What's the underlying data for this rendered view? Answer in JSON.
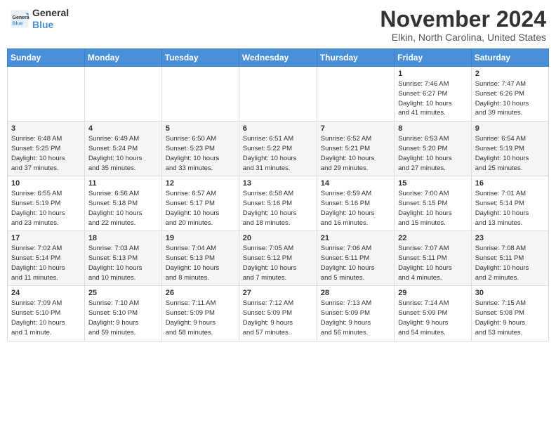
{
  "header": {
    "logo_line1": "General",
    "logo_line2": "Blue",
    "month_year": "November 2024",
    "location": "Elkin, North Carolina, United States"
  },
  "weekdays": [
    "Sunday",
    "Monday",
    "Tuesday",
    "Wednesday",
    "Thursday",
    "Friday",
    "Saturday"
  ],
  "weeks": [
    [
      {
        "day": "",
        "info": ""
      },
      {
        "day": "",
        "info": ""
      },
      {
        "day": "",
        "info": ""
      },
      {
        "day": "",
        "info": ""
      },
      {
        "day": "",
        "info": ""
      },
      {
        "day": "1",
        "info": "Sunrise: 7:46 AM\nSunset: 6:27 PM\nDaylight: 10 hours\nand 41 minutes."
      },
      {
        "day": "2",
        "info": "Sunrise: 7:47 AM\nSunset: 6:26 PM\nDaylight: 10 hours\nand 39 minutes."
      }
    ],
    [
      {
        "day": "3",
        "info": "Sunrise: 6:48 AM\nSunset: 5:25 PM\nDaylight: 10 hours\nand 37 minutes."
      },
      {
        "day": "4",
        "info": "Sunrise: 6:49 AM\nSunset: 5:24 PM\nDaylight: 10 hours\nand 35 minutes."
      },
      {
        "day": "5",
        "info": "Sunrise: 6:50 AM\nSunset: 5:23 PM\nDaylight: 10 hours\nand 33 minutes."
      },
      {
        "day": "6",
        "info": "Sunrise: 6:51 AM\nSunset: 5:22 PM\nDaylight: 10 hours\nand 31 minutes."
      },
      {
        "day": "7",
        "info": "Sunrise: 6:52 AM\nSunset: 5:21 PM\nDaylight: 10 hours\nand 29 minutes."
      },
      {
        "day": "8",
        "info": "Sunrise: 6:53 AM\nSunset: 5:20 PM\nDaylight: 10 hours\nand 27 minutes."
      },
      {
        "day": "9",
        "info": "Sunrise: 6:54 AM\nSunset: 5:19 PM\nDaylight: 10 hours\nand 25 minutes."
      }
    ],
    [
      {
        "day": "10",
        "info": "Sunrise: 6:55 AM\nSunset: 5:19 PM\nDaylight: 10 hours\nand 23 minutes."
      },
      {
        "day": "11",
        "info": "Sunrise: 6:56 AM\nSunset: 5:18 PM\nDaylight: 10 hours\nand 22 minutes."
      },
      {
        "day": "12",
        "info": "Sunrise: 6:57 AM\nSunset: 5:17 PM\nDaylight: 10 hours\nand 20 minutes."
      },
      {
        "day": "13",
        "info": "Sunrise: 6:58 AM\nSunset: 5:16 PM\nDaylight: 10 hours\nand 18 minutes."
      },
      {
        "day": "14",
        "info": "Sunrise: 6:59 AM\nSunset: 5:16 PM\nDaylight: 10 hours\nand 16 minutes."
      },
      {
        "day": "15",
        "info": "Sunrise: 7:00 AM\nSunset: 5:15 PM\nDaylight: 10 hours\nand 15 minutes."
      },
      {
        "day": "16",
        "info": "Sunrise: 7:01 AM\nSunset: 5:14 PM\nDaylight: 10 hours\nand 13 minutes."
      }
    ],
    [
      {
        "day": "17",
        "info": "Sunrise: 7:02 AM\nSunset: 5:14 PM\nDaylight: 10 hours\nand 11 minutes."
      },
      {
        "day": "18",
        "info": "Sunrise: 7:03 AM\nSunset: 5:13 PM\nDaylight: 10 hours\nand 10 minutes."
      },
      {
        "day": "19",
        "info": "Sunrise: 7:04 AM\nSunset: 5:13 PM\nDaylight: 10 hours\nand 8 minutes."
      },
      {
        "day": "20",
        "info": "Sunrise: 7:05 AM\nSunset: 5:12 PM\nDaylight: 10 hours\nand 7 minutes."
      },
      {
        "day": "21",
        "info": "Sunrise: 7:06 AM\nSunset: 5:11 PM\nDaylight: 10 hours\nand 5 minutes."
      },
      {
        "day": "22",
        "info": "Sunrise: 7:07 AM\nSunset: 5:11 PM\nDaylight: 10 hours\nand 4 minutes."
      },
      {
        "day": "23",
        "info": "Sunrise: 7:08 AM\nSunset: 5:11 PM\nDaylight: 10 hours\nand 2 minutes."
      }
    ],
    [
      {
        "day": "24",
        "info": "Sunrise: 7:09 AM\nSunset: 5:10 PM\nDaylight: 10 hours\nand 1 minute."
      },
      {
        "day": "25",
        "info": "Sunrise: 7:10 AM\nSunset: 5:10 PM\nDaylight: 9 hours\nand 59 minutes."
      },
      {
        "day": "26",
        "info": "Sunrise: 7:11 AM\nSunset: 5:09 PM\nDaylight: 9 hours\nand 58 minutes."
      },
      {
        "day": "27",
        "info": "Sunrise: 7:12 AM\nSunset: 5:09 PM\nDaylight: 9 hours\nand 57 minutes."
      },
      {
        "day": "28",
        "info": "Sunrise: 7:13 AM\nSunset: 5:09 PM\nDaylight: 9 hours\nand 56 minutes."
      },
      {
        "day": "29",
        "info": "Sunrise: 7:14 AM\nSunset: 5:09 PM\nDaylight: 9 hours\nand 54 minutes."
      },
      {
        "day": "30",
        "info": "Sunrise: 7:15 AM\nSunset: 5:08 PM\nDaylight: 9 hours\nand 53 minutes."
      }
    ]
  ]
}
